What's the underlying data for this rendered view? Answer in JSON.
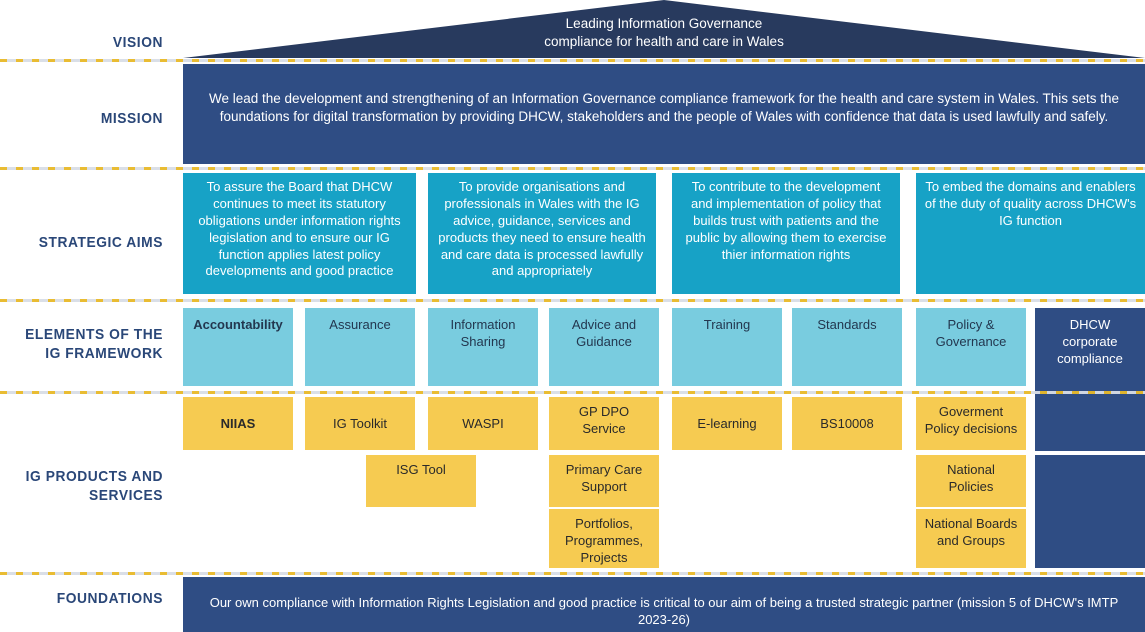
{
  "rows": {
    "vision": {
      "label": "VISION"
    },
    "mission": {
      "label": "MISSION"
    },
    "strategic": {
      "label": "STRATEGIC AIMS"
    },
    "elements": {
      "label": "ELEMENTS OF THE\nIG FRAMEWORK",
      "line1": "ELEMENTS OF THE",
      "line2": "IG FRAMEWORK"
    },
    "products": {
      "label": "IG PRODUCTS\nAND SERVICES",
      "line1": "IG PRODUCTS",
      "line2": "AND SERVICES"
    },
    "foundations": {
      "label": "FOUNDATIONS"
    }
  },
  "vision": {
    "text": "Leading Information Governance compliance for health and care in Wales",
    "line1": "Leading Information Governance",
    "line2": "compliance for health and care in Wales"
  },
  "mission": {
    "text": "We lead the development and strengthening of an Information Governance compliance framework for the health and care system in Wales. This sets the foundations for digital transformation by providing DHCW, stakeholders and the people of Wales with confidence that data is used lawfully and safely."
  },
  "strategic_aims": [
    {
      "text": "To assure the Board that DHCW continues to meet its statutory obligations under information rights legislation and to ensure our IG function applies latest policy developments and good practice"
    },
    {
      "text": "To provide organisations and professionals in Wales with the IG advice, guidance, services and products they need to ensure health and care data is processed lawfully and appropriately"
    },
    {
      "text": "To contribute to the development and implementation of policy that builds trust with patients and the public by allowing them to exercise thier information rights"
    },
    {
      "text": "To embed the domains and enablers of the duty of quality across DHCW's IG function"
    }
  ],
  "elements": [
    {
      "text": "Accountability",
      "bold": true
    },
    {
      "text": "Assurance",
      "bold": false
    },
    {
      "text": "Information Sharing",
      "bold": false
    },
    {
      "text": "Advice and Guidance",
      "bold": false
    },
    {
      "text": "Training",
      "bold": false
    },
    {
      "text": "Standards",
      "bold": false
    },
    {
      "text": "Policy & Governance",
      "bold": false
    }
  ],
  "corporate_compliance": {
    "text": "DHCW corporate compliance"
  },
  "products": {
    "row1": [
      {
        "text": "NIIAS",
        "bold": true
      },
      {
        "text": "IG Toolkit",
        "bold": false
      },
      {
        "text": "WASPI",
        "bold": false
      },
      {
        "text": "GP DPO Service",
        "bold": false
      },
      {
        "text": "E-learning",
        "bold": false
      },
      {
        "text": "BS10008",
        "bold": false
      },
      {
        "text": "Goverment Policy decisions",
        "bold": false
      }
    ],
    "row2": [
      {
        "text": "ISG Tool"
      },
      {
        "text": "Primary Care Support"
      },
      {
        "text": "National Policies"
      }
    ],
    "row3": [
      {
        "text": "Portfolios, Programmes, Projects"
      },
      {
        "text": "National Boards and Groups"
      }
    ]
  },
  "foundations": {
    "text": "Our own compliance with Information Rights Legislation and good practice is critical to our aim of being a trusted strategic partner (mission 5 of DHCW's IMTP 2023-26)"
  },
  "colors": {
    "navy": "#2f4d84",
    "navy_dark": "#283a5e",
    "teal": "#17a2c6",
    "light_blue": "#79ccdf",
    "gold": "#f6cb51",
    "label_blue": "#2a4778",
    "dash_gold": "#e8b928"
  }
}
